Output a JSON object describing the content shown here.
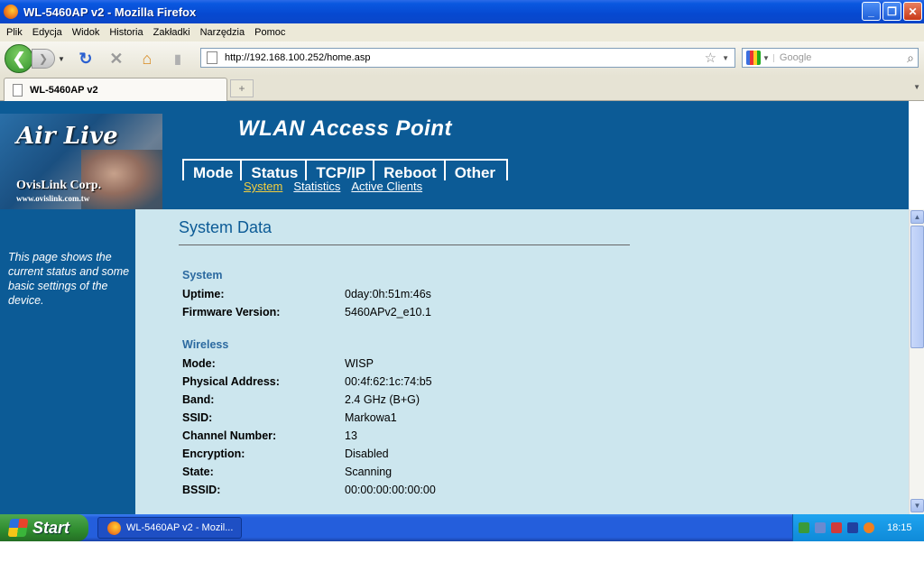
{
  "window": {
    "title": "WL-5460AP v2 - Mozilla Firefox",
    "minimize": "_",
    "maximize": "❐",
    "close": "✕"
  },
  "menu": [
    "Plik",
    "Edycja",
    "Widok",
    "Historia",
    "Zakładki",
    "Narzędzia",
    "Pomoc"
  ],
  "toolbar": {
    "url": "http://192.168.100.252/home.asp",
    "search_placeholder": "Google"
  },
  "tab": {
    "label": "WL-5460AP v2",
    "newtab": "+"
  },
  "header": {
    "brand": "Air Live",
    "corp": "OvisLink Corp.",
    "website": "www.ovislink.com.tw",
    "title": "WLAN Access Point",
    "nav": [
      "Mode",
      "Status",
      "TCP/IP",
      "Reboot",
      "Other"
    ],
    "subnav": [
      "System",
      "Statistics",
      "Active Clients"
    ]
  },
  "sidebar": {
    "text": "This page shows the current status and some basic settings of the device."
  },
  "content": {
    "heading": "System Data",
    "system": {
      "title": "System",
      "rows": [
        {
          "label": "Uptime:",
          "value": "0day:0h:51m:46s"
        },
        {
          "label": "Firmware Version:",
          "value": "5460APv2_e10.1"
        }
      ]
    },
    "wireless": {
      "title": "Wireless",
      "rows": [
        {
          "label": "Mode:",
          "value": "WISP"
        },
        {
          "label": "Physical Address:",
          "value": "00:4f:62:1c:74:b5"
        },
        {
          "label": "Band:",
          "value": "2.4 GHz (B+G)"
        },
        {
          "label": "SSID:",
          "value": "Markowa1"
        },
        {
          "label": "Channel Number:",
          "value": "13"
        },
        {
          "label": "Encryption:",
          "value": "Disabled"
        },
        {
          "label": "State:",
          "value": "Scanning"
        },
        {
          "label": "BSSID:",
          "value": "00:00:00:00:00:00"
        }
      ]
    }
  },
  "taskbar": {
    "start": "Start",
    "task": "WL-5460AP v2 - Mozil...",
    "clock": "18:15"
  }
}
